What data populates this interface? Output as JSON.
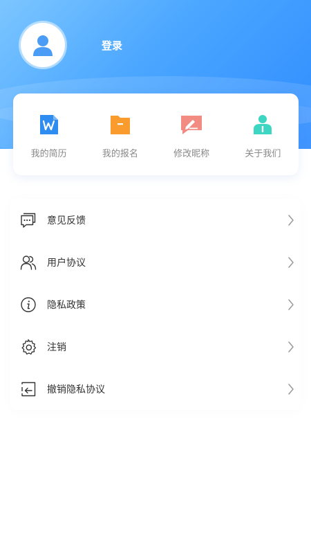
{
  "header": {
    "login_label": "登录",
    "gradient_start": "#7cc6ff",
    "gradient_end": "#2f8cff",
    "avatar_icon": "user-avatar-icon"
  },
  "quick_actions": [
    {
      "label": "我的简历",
      "icon": "word-document-icon",
      "color": "#2f8cf0"
    },
    {
      "label": "我的报名",
      "icon": "folder-icon",
      "color": "#f99c2d"
    },
    {
      "label": "修改昵称",
      "icon": "edit-nickname-icon",
      "color": "#f28b82"
    },
    {
      "label": "关于我们",
      "icon": "about-us-person-icon",
      "color": "#3dd6c2"
    }
  ],
  "menu": [
    {
      "label": "意见反馈",
      "icon": "feedback-chat-icon"
    },
    {
      "label": "用户协议",
      "icon": "users-icon"
    },
    {
      "label": "隐私政策",
      "icon": "info-circle-icon"
    },
    {
      "label": "注销",
      "icon": "gear-icon"
    },
    {
      "label": "撤销隐私协议",
      "icon": "revoke-exit-icon"
    }
  ]
}
